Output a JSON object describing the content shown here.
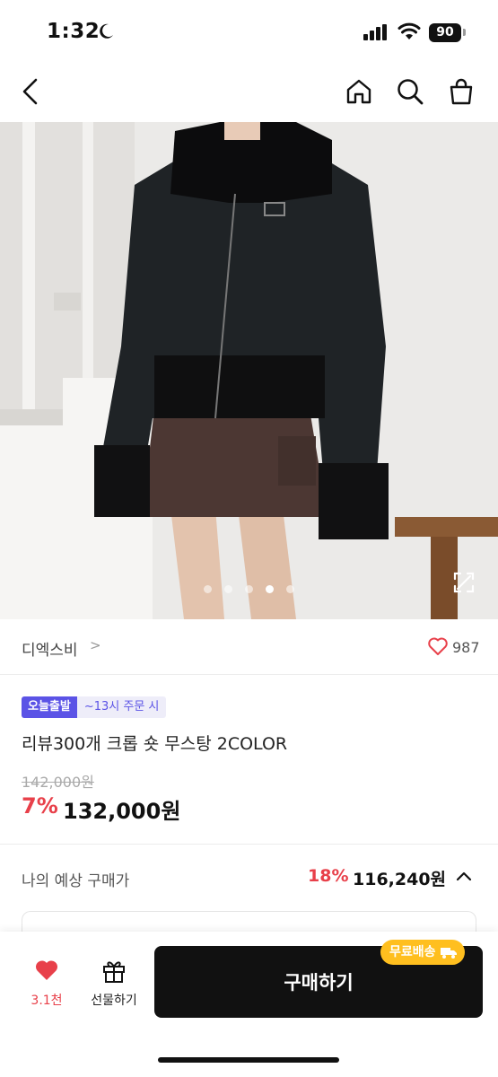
{
  "status": {
    "time": "1:32",
    "battery": "90"
  },
  "header": {
    "back": "back-arrow-icon",
    "home": "home-icon",
    "search": "search-icon",
    "cart": "shopping-bag-icon"
  },
  "gallery": {
    "slide_count": 5,
    "active_index": 3
  },
  "brand": {
    "name": "디엑스비",
    "chevron": ">",
    "like_count": "987"
  },
  "badges": {
    "today": "오늘출발",
    "cutoff": "~13시 주문 시"
  },
  "product": {
    "title": "리뷰300개 크롭 숏 무스탕 2COLOR",
    "original_price": "142,000원",
    "discount": "7%",
    "price": "132,000원"
  },
  "expected": {
    "label": "나의 예상 구매가",
    "discount": "18%",
    "price": "116,240원"
  },
  "bottom": {
    "like_count": "3.1천",
    "gift_label": "선물하기",
    "buy_label": "구매하기",
    "free_shipping": "무료배송"
  },
  "colors": {
    "accent_red": "#e8404a",
    "badge_purple": "#5b53e6",
    "shipping_yellow": "#ffbf1f"
  }
}
